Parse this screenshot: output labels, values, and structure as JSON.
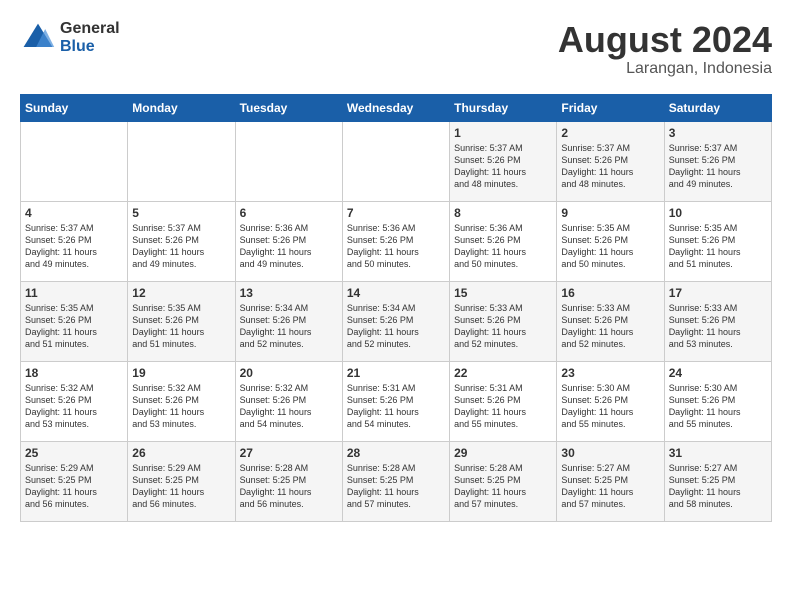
{
  "logo": {
    "general": "General",
    "blue": "Blue"
  },
  "title": "August 2024",
  "subtitle": "Larangan, Indonesia",
  "days_of_week": [
    "Sunday",
    "Monday",
    "Tuesday",
    "Wednesday",
    "Thursday",
    "Friday",
    "Saturday"
  ],
  "weeks": [
    [
      {
        "day": null,
        "info": null
      },
      {
        "day": null,
        "info": null
      },
      {
        "day": null,
        "info": null
      },
      {
        "day": null,
        "info": null
      },
      {
        "day": "1",
        "info": "Sunrise: 5:37 AM\nSunset: 5:26 PM\nDaylight: 11 hours\nand 48 minutes."
      },
      {
        "day": "2",
        "info": "Sunrise: 5:37 AM\nSunset: 5:26 PM\nDaylight: 11 hours\nand 48 minutes."
      },
      {
        "day": "3",
        "info": "Sunrise: 5:37 AM\nSunset: 5:26 PM\nDaylight: 11 hours\nand 49 minutes."
      }
    ],
    [
      {
        "day": "4",
        "info": "Sunrise: 5:37 AM\nSunset: 5:26 PM\nDaylight: 11 hours\nand 49 minutes."
      },
      {
        "day": "5",
        "info": "Sunrise: 5:37 AM\nSunset: 5:26 PM\nDaylight: 11 hours\nand 49 minutes."
      },
      {
        "day": "6",
        "info": "Sunrise: 5:36 AM\nSunset: 5:26 PM\nDaylight: 11 hours\nand 49 minutes."
      },
      {
        "day": "7",
        "info": "Sunrise: 5:36 AM\nSunset: 5:26 PM\nDaylight: 11 hours\nand 50 minutes."
      },
      {
        "day": "8",
        "info": "Sunrise: 5:36 AM\nSunset: 5:26 PM\nDaylight: 11 hours\nand 50 minutes."
      },
      {
        "day": "9",
        "info": "Sunrise: 5:35 AM\nSunset: 5:26 PM\nDaylight: 11 hours\nand 50 minutes."
      },
      {
        "day": "10",
        "info": "Sunrise: 5:35 AM\nSunset: 5:26 PM\nDaylight: 11 hours\nand 51 minutes."
      }
    ],
    [
      {
        "day": "11",
        "info": "Sunrise: 5:35 AM\nSunset: 5:26 PM\nDaylight: 11 hours\nand 51 minutes."
      },
      {
        "day": "12",
        "info": "Sunrise: 5:35 AM\nSunset: 5:26 PM\nDaylight: 11 hours\nand 51 minutes."
      },
      {
        "day": "13",
        "info": "Sunrise: 5:34 AM\nSunset: 5:26 PM\nDaylight: 11 hours\nand 52 minutes."
      },
      {
        "day": "14",
        "info": "Sunrise: 5:34 AM\nSunset: 5:26 PM\nDaylight: 11 hours\nand 52 minutes."
      },
      {
        "day": "15",
        "info": "Sunrise: 5:33 AM\nSunset: 5:26 PM\nDaylight: 11 hours\nand 52 minutes."
      },
      {
        "day": "16",
        "info": "Sunrise: 5:33 AM\nSunset: 5:26 PM\nDaylight: 11 hours\nand 52 minutes."
      },
      {
        "day": "17",
        "info": "Sunrise: 5:33 AM\nSunset: 5:26 PM\nDaylight: 11 hours\nand 53 minutes."
      }
    ],
    [
      {
        "day": "18",
        "info": "Sunrise: 5:32 AM\nSunset: 5:26 PM\nDaylight: 11 hours\nand 53 minutes."
      },
      {
        "day": "19",
        "info": "Sunrise: 5:32 AM\nSunset: 5:26 PM\nDaylight: 11 hours\nand 53 minutes."
      },
      {
        "day": "20",
        "info": "Sunrise: 5:32 AM\nSunset: 5:26 PM\nDaylight: 11 hours\nand 54 minutes."
      },
      {
        "day": "21",
        "info": "Sunrise: 5:31 AM\nSunset: 5:26 PM\nDaylight: 11 hours\nand 54 minutes."
      },
      {
        "day": "22",
        "info": "Sunrise: 5:31 AM\nSunset: 5:26 PM\nDaylight: 11 hours\nand 55 minutes."
      },
      {
        "day": "23",
        "info": "Sunrise: 5:30 AM\nSunset: 5:26 PM\nDaylight: 11 hours\nand 55 minutes."
      },
      {
        "day": "24",
        "info": "Sunrise: 5:30 AM\nSunset: 5:26 PM\nDaylight: 11 hours\nand 55 minutes."
      }
    ],
    [
      {
        "day": "25",
        "info": "Sunrise: 5:29 AM\nSunset: 5:25 PM\nDaylight: 11 hours\nand 56 minutes."
      },
      {
        "day": "26",
        "info": "Sunrise: 5:29 AM\nSunset: 5:25 PM\nDaylight: 11 hours\nand 56 minutes."
      },
      {
        "day": "27",
        "info": "Sunrise: 5:28 AM\nSunset: 5:25 PM\nDaylight: 11 hours\nand 56 minutes."
      },
      {
        "day": "28",
        "info": "Sunrise: 5:28 AM\nSunset: 5:25 PM\nDaylight: 11 hours\nand 57 minutes."
      },
      {
        "day": "29",
        "info": "Sunrise: 5:28 AM\nSunset: 5:25 PM\nDaylight: 11 hours\nand 57 minutes."
      },
      {
        "day": "30",
        "info": "Sunrise: 5:27 AM\nSunset: 5:25 PM\nDaylight: 11 hours\nand 57 minutes."
      },
      {
        "day": "31",
        "info": "Sunrise: 5:27 AM\nSunset: 5:25 PM\nDaylight: 11 hours\nand 58 minutes."
      }
    ]
  ]
}
